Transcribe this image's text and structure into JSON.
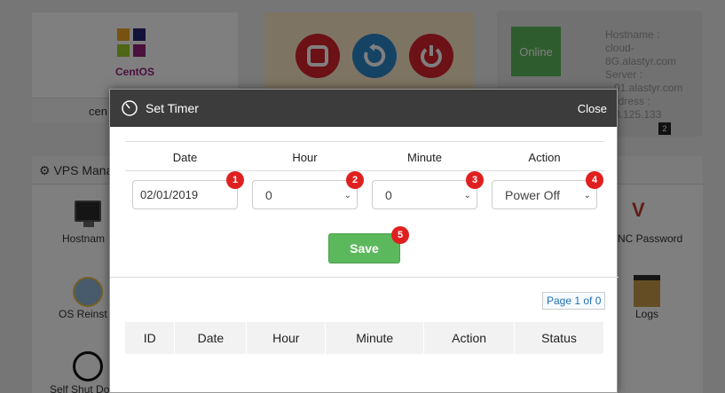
{
  "background": {
    "logo_text": "CentOS",
    "server_name_partial": "cen",
    "status_online": "Online",
    "info_lines": [
      "Hostname :",
      "cloud-",
      "8G.alastyr.com",
      "Server :",
      "...01.alastyr.com",
      "Address :",
      "...8.125.133"
    ],
    "counter_badge": "2",
    "manage_title": "VPS Mana",
    "tools": {
      "hostname": "Hostnam",
      "os_reinstall": "OS Reinst",
      "self_shutdown": "Self Shut Do",
      "vnc_password": "NC Password",
      "logs": "Logs"
    },
    "vnc_icon_text": "V",
    "power_buttons": [
      "stop-icon",
      "restart-icon",
      "power-icon"
    ]
  },
  "modal": {
    "title": "Set Timer",
    "close_label": "Close",
    "form": {
      "headers": [
        "Date",
        "Hour",
        "Minute",
        "Action"
      ],
      "date_value": "02/01/2019",
      "hour_value": "0",
      "minute_value": "0",
      "action_value": "Power Off",
      "badges": [
        "1",
        "2",
        "3",
        "4"
      ]
    },
    "save_label": "Save",
    "save_badge": "5",
    "pagination": "Page 1 of 0",
    "table_headers": [
      "ID",
      "Date",
      "Hour",
      "Minute",
      "Action",
      "Status"
    ]
  },
  "colors": {
    "header_bg": "#3c3c3c",
    "save_green": "#5cb85c",
    "badge_red": "#e02020",
    "link_blue": "#1f6fb2"
  }
}
